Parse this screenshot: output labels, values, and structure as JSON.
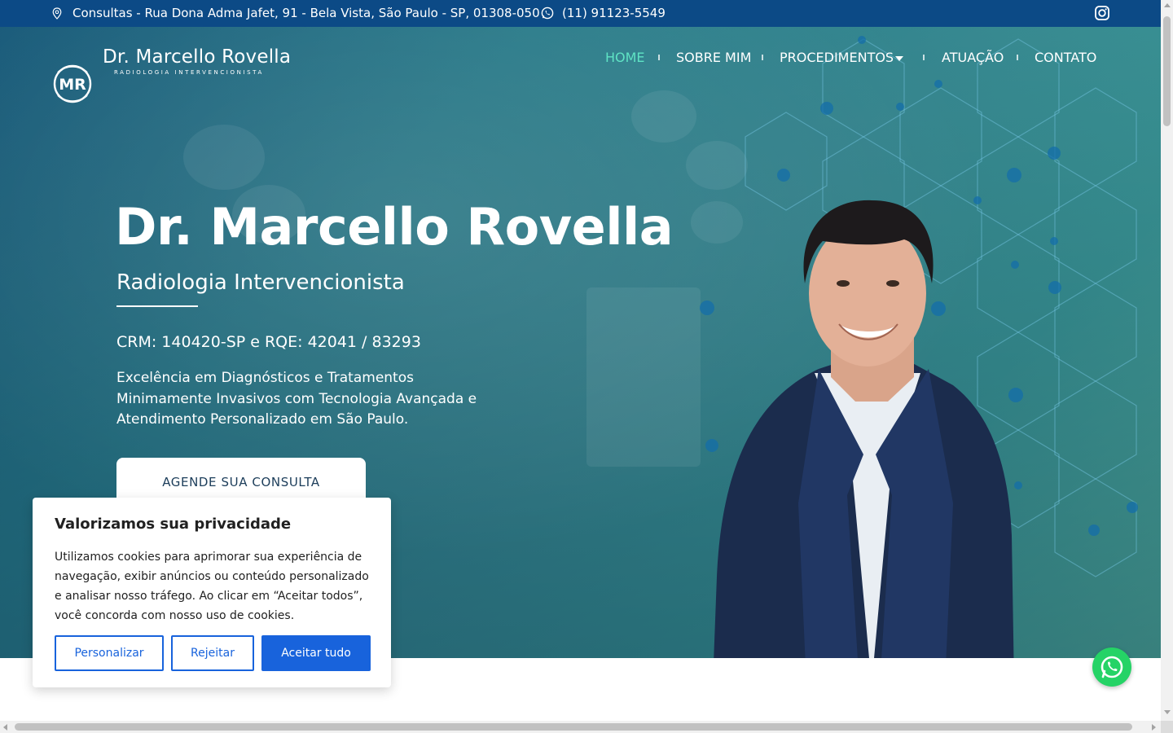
{
  "topbar": {
    "address": "Consultas - Rua Dona Adma Jafet, 91 - Bela Vista, São Paulo - SP, 01308-050",
    "phone": "(11) 91123-5549",
    "icons": [
      "map-pin-icon",
      "whatsapp-icon",
      "instagram-icon"
    ]
  },
  "logo": {
    "monogram": "MR",
    "name": "Dr. Marcello Rovella",
    "tagline": "RADIOLOGIA INTERVENCIONISTA"
  },
  "nav": {
    "items": [
      {
        "label": "HOME",
        "active": true
      },
      {
        "label": "SOBRE MIM",
        "active": false
      },
      {
        "label": "PROCEDIMENTOS",
        "active": false,
        "has_dropdown": true
      },
      {
        "label": "ATUAÇÃO",
        "active": false
      },
      {
        "label": "CONTATO",
        "active": false
      }
    ]
  },
  "hero": {
    "title": "Dr. Marcello Rovella",
    "subtitle": "Radiologia Intervencionista",
    "crm": "CRM: 140420-SP e RQE: 42041 / 83293",
    "description": "Excelência em Diagnósticos e Tratamentos Minimamente Invasivos com Tecnologia Avançada e Atendimento Personalizado em São Paulo.",
    "cta": "AGENDE SUA CONSULTA"
  },
  "cookie": {
    "title": "Valorizamos sua privacidade",
    "text": "Utilizamos cookies para aprimorar sua experiência de navegação, exibir anúncios ou conteúdo personalizado e analisar nosso tráfego. Ao clicar em “Aceitar todos”, você concorda com nosso uso de cookies.",
    "buttons": {
      "customize": "Personalizar",
      "reject": "Rejeitar",
      "accept": "Aceitar tudo"
    }
  },
  "colors": {
    "topbar": "#0c4a86",
    "accent_active": "#5fe3c4",
    "cookie_primary": "#1863dc",
    "whatsapp": "#25d366"
  }
}
